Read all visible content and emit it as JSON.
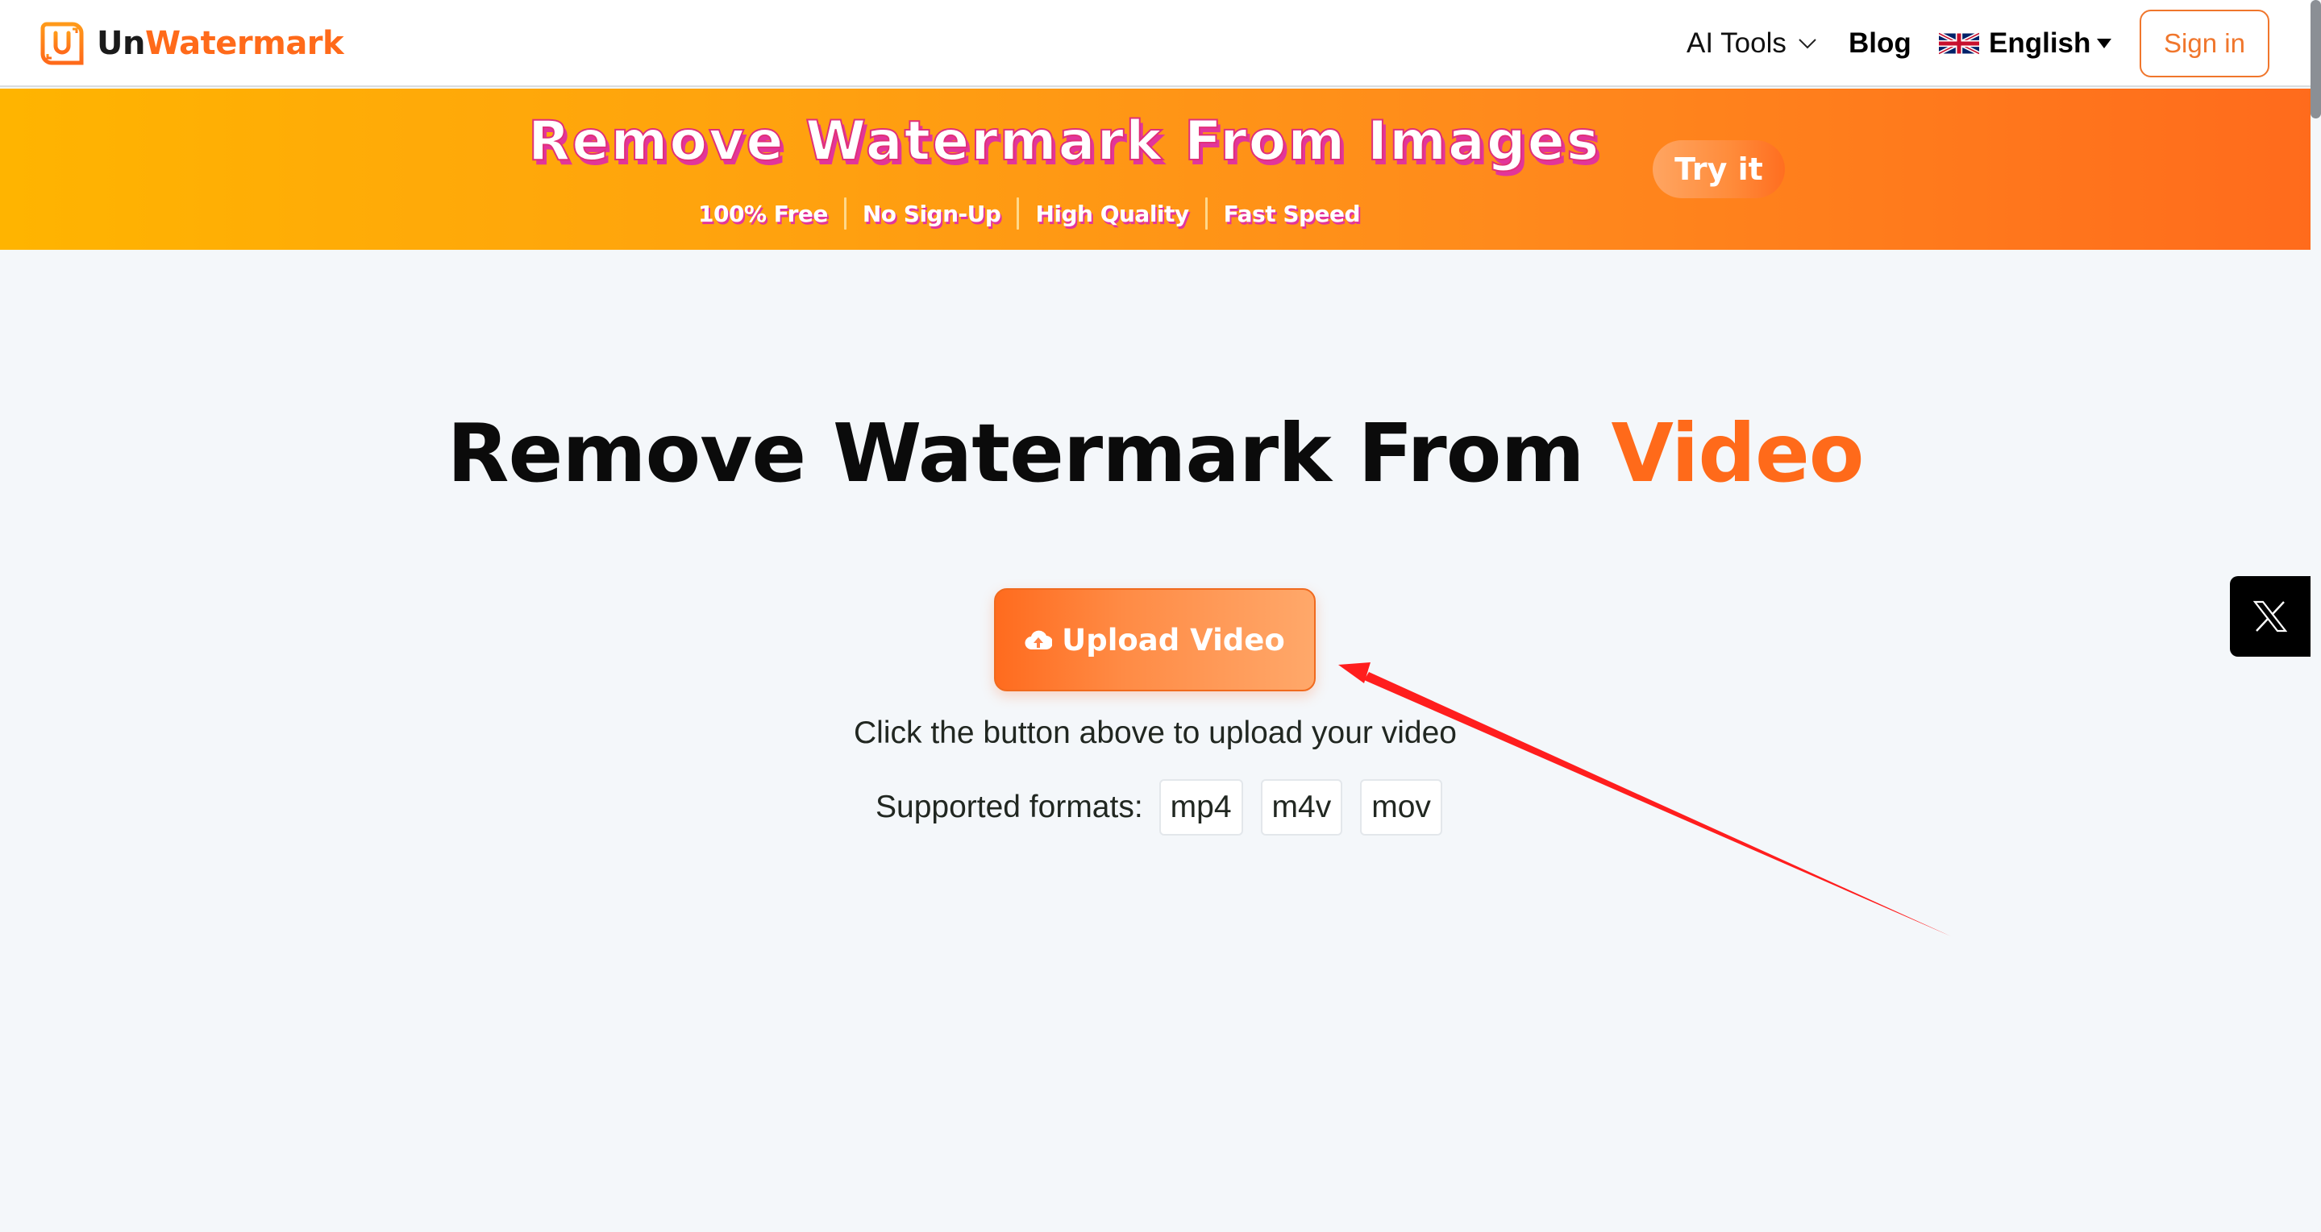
{
  "header": {
    "logo": {
      "prefix": "Un",
      "suffix": "Watermark",
      "icon": "unwatermark-logo-icon"
    },
    "nav": {
      "ai_tools": "AI Tools",
      "blog": "Blog",
      "language": "English"
    },
    "sign_in": "Sign in"
  },
  "banner": {
    "title": "Remove Watermark From Images",
    "features": [
      "100% Free",
      "No Sign-Up",
      "High Quality",
      "Fast Speed"
    ],
    "cta": "Try it",
    "colors": {
      "start": "#FFB400",
      "end": "#FF6B1C",
      "text_shadow": "#E2359B"
    }
  },
  "main": {
    "title_prefix": "Remove Watermark From ",
    "title_accent": "Video",
    "upload_button": "Upload Video",
    "hint": "Click the button above to upload your video",
    "formats_label": "Supported formats:",
    "formats": [
      "mp4",
      "m4v",
      "mov"
    ]
  },
  "social": {
    "x_icon": "x-twitter-icon"
  },
  "annotation": {
    "type": "arrow",
    "color": "#FF1E1E",
    "points_to": "upload-video-button"
  },
  "theme": {
    "accent": "#FF6A1A",
    "background": "#F4F7FA"
  }
}
